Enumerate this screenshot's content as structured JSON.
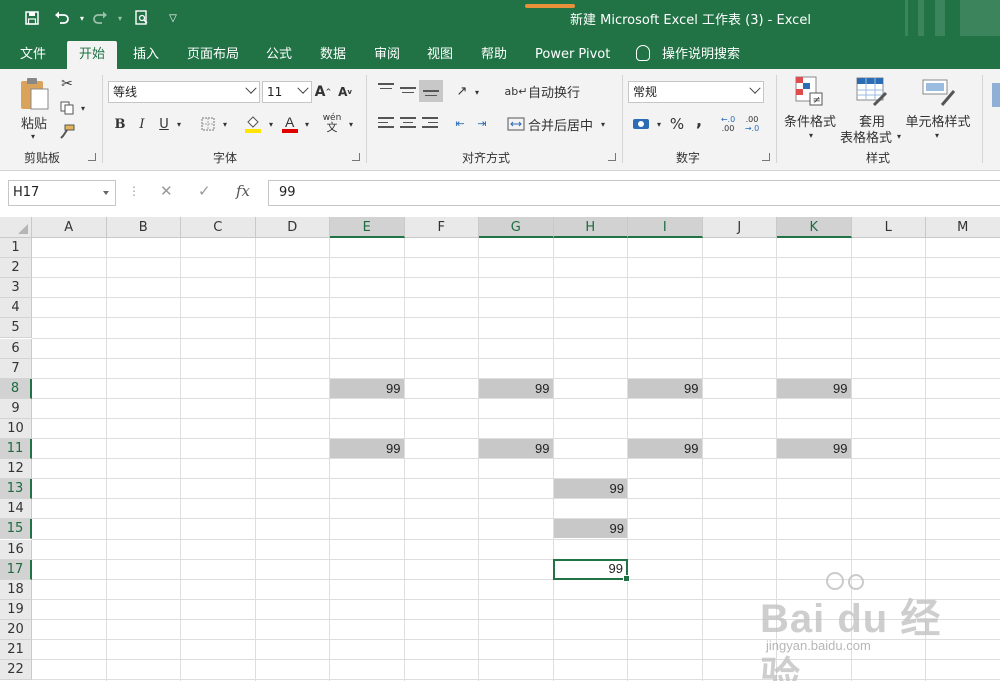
{
  "title_bar": {
    "title": "新建 Microsoft Excel 工作表 (3)  -  Excel"
  },
  "tabs": [
    {
      "label": "文件",
      "active": false
    },
    {
      "label": "开始",
      "active": true
    },
    {
      "label": "插入",
      "active": false
    },
    {
      "label": "页面布局",
      "active": false
    },
    {
      "label": "公式",
      "active": false
    },
    {
      "label": "数据",
      "active": false
    },
    {
      "label": "审阅",
      "active": false
    },
    {
      "label": "视图",
      "active": false
    },
    {
      "label": "帮助",
      "active": false
    },
    {
      "label": "Power Pivot",
      "active": false
    }
  ],
  "tell_me": "操作说明搜索",
  "ribbon": {
    "clipboard": {
      "paste_label": "粘贴",
      "group_label": "剪贴板"
    },
    "font": {
      "font_name": "等线",
      "font_size": "11",
      "bold": "B",
      "italic": "I",
      "underline": "U",
      "phonetic": "wén",
      "group_label": "字体"
    },
    "alignment": {
      "wrap_label": "自动换行",
      "merge_label": "合并后居中",
      "group_label": "对齐方式"
    },
    "number": {
      "format": "常规",
      "percent": "%",
      "comma": ",",
      "group_label": "数字"
    },
    "styles": {
      "conditional_label": "条件格式",
      "table_label_1": "套用",
      "table_label_2": "表格格式",
      "cell_styles_label": "单元格样式",
      "group_label": "样式"
    }
  },
  "formula_bar": {
    "name_box": "H17",
    "fx": "fx",
    "value": "99"
  },
  "columns": [
    "A",
    "B",
    "C",
    "D",
    "E",
    "F",
    "G",
    "H",
    "I",
    "J",
    "K",
    "L",
    "M"
  ],
  "selected_columns": [
    "E",
    "G",
    "H",
    "I",
    "K"
  ],
  "rows": [
    "1",
    "2",
    "3",
    "4",
    "5",
    "6",
    "7",
    "8",
    "9",
    "10",
    "11",
    "12",
    "13",
    "14",
    "15",
    "16",
    "17",
    "18",
    "19",
    "20",
    "21",
    "22"
  ],
  "selected_rows": [
    "8",
    "11",
    "13",
    "15",
    "17"
  ],
  "cells": [
    {
      "ref": "E8",
      "value": "99"
    },
    {
      "ref": "G8",
      "value": "99"
    },
    {
      "ref": "I8",
      "value": "99"
    },
    {
      "ref": "K8",
      "value": "99"
    },
    {
      "ref": "E11",
      "value": "99"
    },
    {
      "ref": "G11",
      "value": "99"
    },
    {
      "ref": "I11",
      "value": "99"
    },
    {
      "ref": "K11",
      "value": "99"
    },
    {
      "ref": "H13",
      "value": "99"
    },
    {
      "ref": "H15",
      "value": "99"
    },
    {
      "ref": "H17",
      "value": "99"
    }
  ],
  "active_cell": "H17",
  "watermark": {
    "text": "Bai du 经验",
    "url": "jingyan.baidu.com"
  },
  "colors": {
    "excel_green": "#217346",
    "selection_fill": "#c8c8c8"
  }
}
